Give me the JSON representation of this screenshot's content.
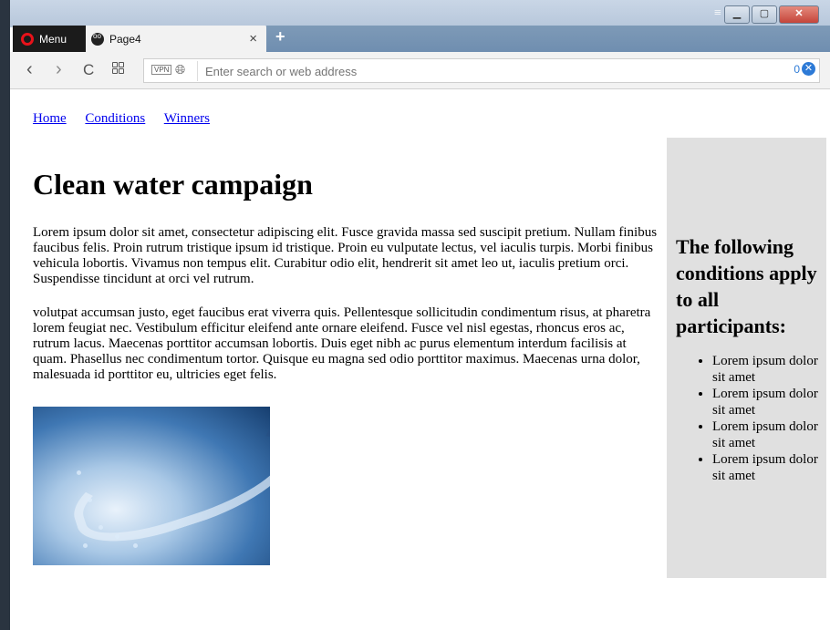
{
  "browser": {
    "menu_label": "Menu",
    "tab_title": "Page4",
    "tab_close": "×",
    "new_tab": "+",
    "address_placeholder": "Enter search or web address",
    "vpn_label": "VPN",
    "adblock_count": "0"
  },
  "nav": {
    "links": [
      "Home",
      "Conditions",
      "Winners"
    ]
  },
  "main": {
    "title": "Clean water campaign",
    "paragraph1": "Lorem ipsum dolor sit amet, consectetur adipiscing elit. Fusce gravida massa sed suscipit pretium. Nullam finibus faucibus felis. Proin rutrum tristique ipsum id tristique. Proin eu vulputate lectus, vel iaculis turpis. Morbi finibus vehicula lobortis. Vivamus non tempus elit. Curabitur odio elit, hendrerit sit amet leo ut, iaculis pretium orci. Suspendisse tincidunt at orci vel rutrum.",
    "paragraph2": "volutpat accumsan justo, eget faucibus erat viverra quis. Pellentesque sollicitudin condimentum risus, at pharetra lorem feugiat nec. Vestibulum efficitur eleifend ante ornare eleifend. Fusce vel nisl egestas, rhoncus eros ac, rutrum lacus. Maecenas porttitor accumsan lobortis. Duis eget nibh ac purus elementum interdum facilisis at quam. Phasellus nec condimentum tortor. Quisque eu magna sed odio porttitor maximus. Maecenas urna dolor, malesuada id porttitor eu, ultricies eget felis."
  },
  "sidebar": {
    "title": "The following conditions apply to all participants:",
    "items": [
      "Lorem ipsum dolor sit amet",
      "Lorem ipsum dolor sit amet",
      "Lorem ipsum dolor sit amet",
      "Lorem ipsum dolor sit amet"
    ]
  }
}
